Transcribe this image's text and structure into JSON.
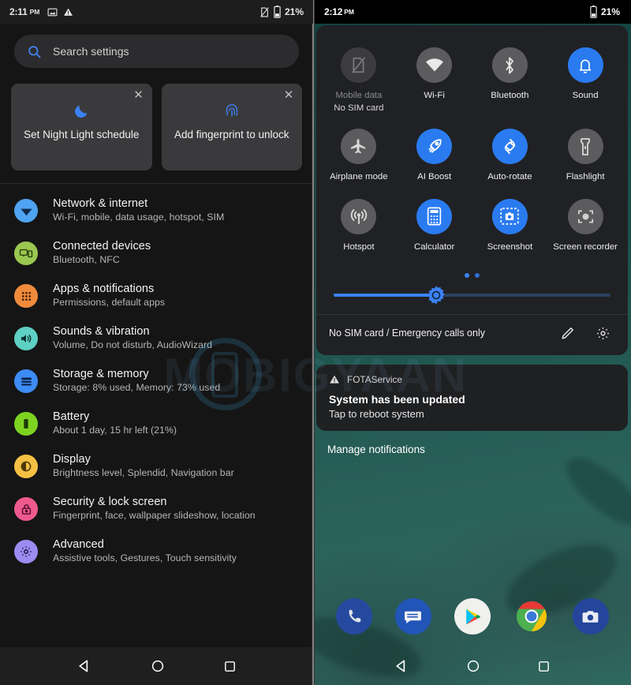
{
  "left_panel": {
    "statusbar": {
      "time": "2:11",
      "ampm": "PM",
      "icons": [
        "image-icon",
        "warning-icon"
      ],
      "battery_percent": "21%",
      "right_icons": [
        "no-sim-icon",
        "battery-icon"
      ]
    },
    "search": {
      "placeholder": "Search settings",
      "icon": "search-icon"
    },
    "suggestion_cards": [
      {
        "label": "Set Night Light schedule",
        "icon": "moon-icon",
        "close": "✕"
      },
      {
        "label": "Add fingerprint to unlock",
        "icon": "fingerprint-icon",
        "close": "✕"
      }
    ],
    "settings": [
      {
        "title": "Network & internet",
        "subtitle": "Wi-Fi, mobile, data usage, hotspot, SIM",
        "icon": "network-icon",
        "color": "#4fa3f0"
      },
      {
        "title": "Connected devices",
        "subtitle": "Bluetooth, NFC",
        "icon": "connected-devices-icon",
        "color": "#9ac750"
      },
      {
        "title": "Apps & notifications",
        "subtitle": "Permissions, default apps",
        "icon": "apps-grid-icon",
        "color": "#f08b3c"
      },
      {
        "title": "Sounds & vibration",
        "subtitle": "Volume, Do not disturb, AudioWizard",
        "icon": "speaker-icon",
        "color": "#5fd0c4"
      },
      {
        "title": "Storage & memory",
        "subtitle": "Storage: 8% used, Memory: 73% used",
        "icon": "storage-icon",
        "color": "#3d8bf5"
      },
      {
        "title": "Battery",
        "subtitle": "About 1 day, 15 hr left (21%)",
        "icon": "battery-icon",
        "color": "#7ed321"
      },
      {
        "title": "Display",
        "subtitle": "Brightness level, Splendid, Navigation bar",
        "icon": "brightness-icon",
        "color": "#f5c043"
      },
      {
        "title": "Security & lock screen",
        "subtitle": "Fingerprint, face, wallpaper slideshow, location",
        "icon": "lock-icon",
        "color": "#ef5a8e"
      },
      {
        "title": "Advanced",
        "subtitle": "Assistive tools, Gestures, Touch sensitivity",
        "icon": "gear-icon",
        "color": "#9b8cf0"
      }
    ],
    "navbar": [
      "back-icon",
      "home-icon",
      "recents-icon"
    ]
  },
  "right_panel": {
    "statusbar": {
      "time": "2:12",
      "ampm": "PM",
      "battery_percent": "21%"
    },
    "tiles": [
      {
        "label": "Mobile data",
        "sublabel": "No SIM card",
        "icon": "no-sim-icon",
        "state": "disabled"
      },
      {
        "label": "Wi-Fi",
        "sublabel": "",
        "icon": "wifi-icon",
        "state": "off"
      },
      {
        "label": "Bluetooth",
        "sublabel": "",
        "icon": "bluetooth-icon",
        "state": "off"
      },
      {
        "label": "Sound",
        "sublabel": "",
        "icon": "bell-icon",
        "state": "on"
      },
      {
        "label": "Airplane mode",
        "sublabel": "",
        "icon": "airplane-icon",
        "state": "off"
      },
      {
        "label": "AI Boost",
        "sublabel": "",
        "icon": "rocket-icon",
        "state": "on"
      },
      {
        "label": "Auto-rotate",
        "sublabel": "",
        "icon": "auto-rotate-icon",
        "state": "on"
      },
      {
        "label": "Flashlight",
        "sublabel": "",
        "icon": "flashlight-icon",
        "state": "off"
      },
      {
        "label": "Hotspot",
        "sublabel": "",
        "icon": "hotspot-icon",
        "state": "off"
      },
      {
        "label": "Calculator",
        "sublabel": "",
        "icon": "calculator-icon",
        "state": "on"
      },
      {
        "label": "Screenshot",
        "sublabel": "",
        "icon": "screenshot-icon",
        "state": "on"
      },
      {
        "label": "Screen recorder",
        "sublabel": "",
        "icon": "screen-recorder-icon",
        "state": "off"
      }
    ],
    "pager": {
      "pages": 2,
      "active": 1
    },
    "brightness": {
      "value_percent": 37,
      "icon": "brightness-knob-icon"
    },
    "footer": {
      "carrier": "No SIM card / Emergency calls only",
      "edit_icon": "pencil-icon",
      "settings_icon": "gear-icon"
    },
    "notification": {
      "app": "FOTAService",
      "app_icon": "warning-icon",
      "title": "System has been updated",
      "body": "Tap to reboot system"
    },
    "manage_label": "Manage notifications",
    "dock": [
      "phone-icon",
      "messages-icon",
      "play-store-icon",
      "chrome-icon",
      "camera-icon"
    ],
    "navbar": [
      "back-icon",
      "home-icon",
      "recents-icon"
    ]
  },
  "watermark": {
    "text": "MOBIGYAAN"
  },
  "colors": {
    "accent": "#3b82f6",
    "tile_on": "#2a7bf0",
    "tile_off": "#5c5c5e",
    "panel_bg": "#202124",
    "settings_bg": "#151515"
  }
}
